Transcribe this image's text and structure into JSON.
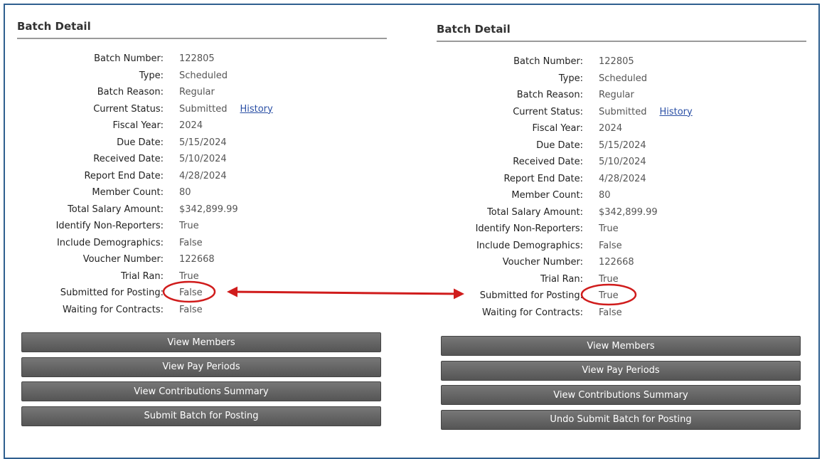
{
  "left_panel": {
    "title": "Batch Detail",
    "rows": [
      {
        "label": "Batch Number:",
        "value": "122805"
      },
      {
        "label": "Type:",
        "value": "Scheduled"
      },
      {
        "label": "Batch Reason:",
        "value": "Regular"
      },
      {
        "label": "Current Status:",
        "value": "Submitted",
        "link": "History"
      },
      {
        "label": "Fiscal Year:",
        "value": "2024"
      },
      {
        "label": "Due Date:",
        "value": "5/15/2024"
      },
      {
        "label": "Received Date:",
        "value": "5/10/2024"
      },
      {
        "label": "Report End Date:",
        "value": "4/28/2024"
      },
      {
        "label": "Member Count:",
        "value": "80"
      },
      {
        "label": "Total Salary Amount:",
        "value": "$342,899.99"
      },
      {
        "label": "Identify Non-Reporters:",
        "value": "True"
      },
      {
        "label": "Include Demographics:",
        "value": "False"
      },
      {
        "label": "Voucher Number:",
        "value": "122668"
      },
      {
        "label": "Trial Ran:",
        "value": "True"
      },
      {
        "label": "Submitted for Posting:",
        "value": "False"
      },
      {
        "label": "Waiting for Contracts:",
        "value": "False"
      }
    ],
    "buttons": [
      "View Members",
      "View Pay Periods",
      "View Contributions Summary",
      "Submit Batch for Posting"
    ]
  },
  "right_panel": {
    "title": "Batch Detail",
    "rows": [
      {
        "label": "Batch Number:",
        "value": "122805"
      },
      {
        "label": "Type:",
        "value": "Scheduled"
      },
      {
        "label": "Batch Reason:",
        "value": "Regular"
      },
      {
        "label": "Current Status:",
        "value": "Submitted",
        "link": "History"
      },
      {
        "label": "Fiscal Year:",
        "value": "2024"
      },
      {
        "label": "Due Date:",
        "value": "5/15/2024"
      },
      {
        "label": "Received Date:",
        "value": "5/10/2024"
      },
      {
        "label": "Report End Date:",
        "value": "4/28/2024"
      },
      {
        "label": "Member Count:",
        "value": "80"
      },
      {
        "label": "Total Salary Amount:",
        "value": "$342,899.99"
      },
      {
        "label": "Identify Non-Reporters:",
        "value": "True"
      },
      {
        "label": "Include Demographics:",
        "value": "False"
      },
      {
        "label": "Voucher Number:",
        "value": "122668"
      },
      {
        "label": "Trial Ran:",
        "value": "True"
      },
      {
        "label": "Submitted for Posting:",
        "value": "True"
      },
      {
        "label": "Waiting for Contracts:",
        "value": "False"
      }
    ],
    "buttons": [
      "View Members",
      "View Pay Periods",
      "View Contributions Summary",
      "Undo Submit Batch for Posting"
    ]
  },
  "annotation": {
    "color": "#d01c1c"
  }
}
